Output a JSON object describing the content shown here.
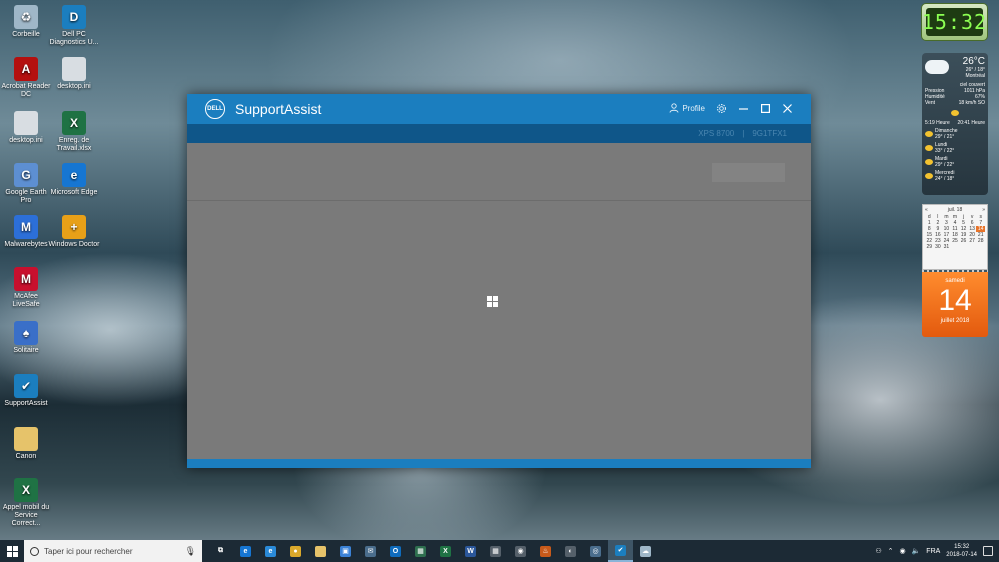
{
  "desktop_icons": [
    {
      "label": "Corbeille",
      "icon": "recycle-bin-icon",
      "color": "#9fb7c8",
      "glyph": "♻"
    },
    {
      "label": "Dell PC Diagnostics U...",
      "icon": "dell-diagnostics-icon",
      "color": "#1b7ebf",
      "glyph": "D"
    },
    {
      "label": "Acrobat Reader DC",
      "icon": "acrobat-icon",
      "color": "#b4100f",
      "glyph": "A"
    },
    {
      "label": "desktop.ini",
      "icon": "file-icon",
      "color": "#d8dde2",
      "glyph": ""
    },
    {
      "label": "desktop.ini",
      "icon": "file-icon",
      "color": "#d8dde2",
      "glyph": ""
    },
    {
      "label": "Enreg. de Travail.xlsx",
      "icon": "excel-file-icon",
      "color": "#1f7244",
      "glyph": "X"
    },
    {
      "label": "Google Earth Pro",
      "icon": "google-earth-icon",
      "color": "#5d8fd2",
      "glyph": "G"
    },
    {
      "label": "Microsoft Edge",
      "icon": "edge-icon",
      "color": "#1676d2",
      "glyph": "e"
    },
    {
      "label": "Malwarebytes",
      "icon": "malwarebytes-icon",
      "color": "#2c6fd8",
      "glyph": "M"
    },
    {
      "label": "Windows Doctor",
      "icon": "windows-doctor-icon",
      "color": "#e8a018",
      "glyph": "+"
    },
    {
      "label": "McAfee LiveSafe",
      "icon": "mcafee-icon",
      "color": "#c8102e",
      "glyph": "M"
    },
    {
      "label": "Solitaire",
      "icon": "solitaire-icon",
      "color": "#3a6fc8",
      "glyph": "♠"
    },
    {
      "label": "SupportAssist",
      "icon": "supportassist-icon",
      "color": "#1b7ebf",
      "glyph": "✔"
    },
    {
      "label": "Canon",
      "icon": "canon-folder-icon",
      "color": "#e6c36a",
      "glyph": ""
    },
    {
      "label": "Appel mobil du Service Correct...",
      "icon": "excel-file-icon",
      "color": "#1f7244",
      "glyph": "X"
    }
  ],
  "window": {
    "logo": "DELL",
    "title": "SupportAssist",
    "profile_label": "Profile",
    "model": "XPS 8700",
    "separator": "|",
    "service_tag": "9G1TFX1"
  },
  "widgets": {
    "clock": "15:32",
    "weather": {
      "temp": "26°C",
      "range": "26° / 18°",
      "city": "Montréal",
      "condition": "ciel couvert",
      "rows": [
        {
          "label": "Pression",
          "value": "1011 hPa"
        },
        {
          "label": "Humidité",
          "value": "67%"
        },
        {
          "label": "Vent",
          "value": "18 km/h SO"
        }
      ],
      "sunrise": "5:19 Heure",
      "sunset": "20:41 Heure",
      "forecast": [
        {
          "day": "Dimanche",
          "temps": "29° / 21°"
        },
        {
          "day": "Lundi",
          "temps": "33° / 22°"
        },
        {
          "day": "Mardi",
          "temps": "29° / 22°"
        },
        {
          "day": "Mercredi",
          "temps": "24° / 18°"
        }
      ]
    },
    "calendar": {
      "month": "juil. 18",
      "days_header": [
        "d",
        "l",
        "m",
        "m",
        "j",
        "v",
        "s"
      ],
      "weeks": [
        [
          "1",
          "2",
          "3",
          "4",
          "5",
          "6",
          "7"
        ],
        [
          "8",
          "9",
          "10",
          "11",
          "12",
          "13",
          "14"
        ],
        [
          "15",
          "16",
          "17",
          "18",
          "19",
          "20",
          "21"
        ],
        [
          "22",
          "23",
          "24",
          "25",
          "26",
          "27",
          "28"
        ],
        [
          "29",
          "30",
          "31",
          "",
          "",
          "",
          ""
        ]
      ],
      "today": "14"
    },
    "date": {
      "weekday": "samedi",
      "day": "14",
      "month_year": "juillet 2018"
    }
  },
  "taskbar": {
    "search_placeholder": "Taper ici pour rechercher",
    "apps": [
      {
        "name": "task-view-icon",
        "color": "#1c2a35",
        "glyph": "⧉"
      },
      {
        "name": "edge-taskbar-icon",
        "color": "#1676d2",
        "glyph": "e"
      },
      {
        "name": "ie-taskbar-icon",
        "color": "#2a8ad8",
        "glyph": "e"
      },
      {
        "name": "chrome-taskbar-icon",
        "color": "#d9a82b",
        "glyph": "●"
      },
      {
        "name": "file-explorer-icon",
        "color": "#e6c36a",
        "glyph": ""
      },
      {
        "name": "store-icon",
        "color": "#3b82d6",
        "glyph": "▣"
      },
      {
        "name": "mail-icon",
        "color": "#4a6d8c",
        "glyph": "✉"
      },
      {
        "name": "outlook-icon",
        "color": "#0f6cbd",
        "glyph": "O"
      },
      {
        "name": "photos-icon",
        "color": "#2e6f4f",
        "glyph": "▦"
      },
      {
        "name": "excel-taskbar-icon",
        "color": "#1f7244",
        "glyph": "X"
      },
      {
        "name": "word-taskbar-icon",
        "color": "#2b579a",
        "glyph": "W"
      },
      {
        "name": "calculator-icon",
        "color": "#55606a",
        "glyph": "▦"
      },
      {
        "name": "camera-icon",
        "color": "#55606a",
        "glyph": "◉"
      },
      {
        "name": "flame-app-icon",
        "color": "#c85a1a",
        "glyph": "♨"
      },
      {
        "name": "game-controller-icon",
        "color": "#55606a",
        "glyph": "◐"
      },
      {
        "name": "security-shield-icon",
        "color": "#4a6d8c",
        "glyph": "◎"
      },
      {
        "name": "supportassist-taskbar-icon",
        "color": "#1b7ebf",
        "glyph": "✔",
        "active": true
      },
      {
        "name": "cloud-app-icon",
        "color": "#9fb7c8",
        "glyph": "☁"
      }
    ],
    "language": "FRA",
    "time": "15:32",
    "date": "2018-07-14"
  }
}
